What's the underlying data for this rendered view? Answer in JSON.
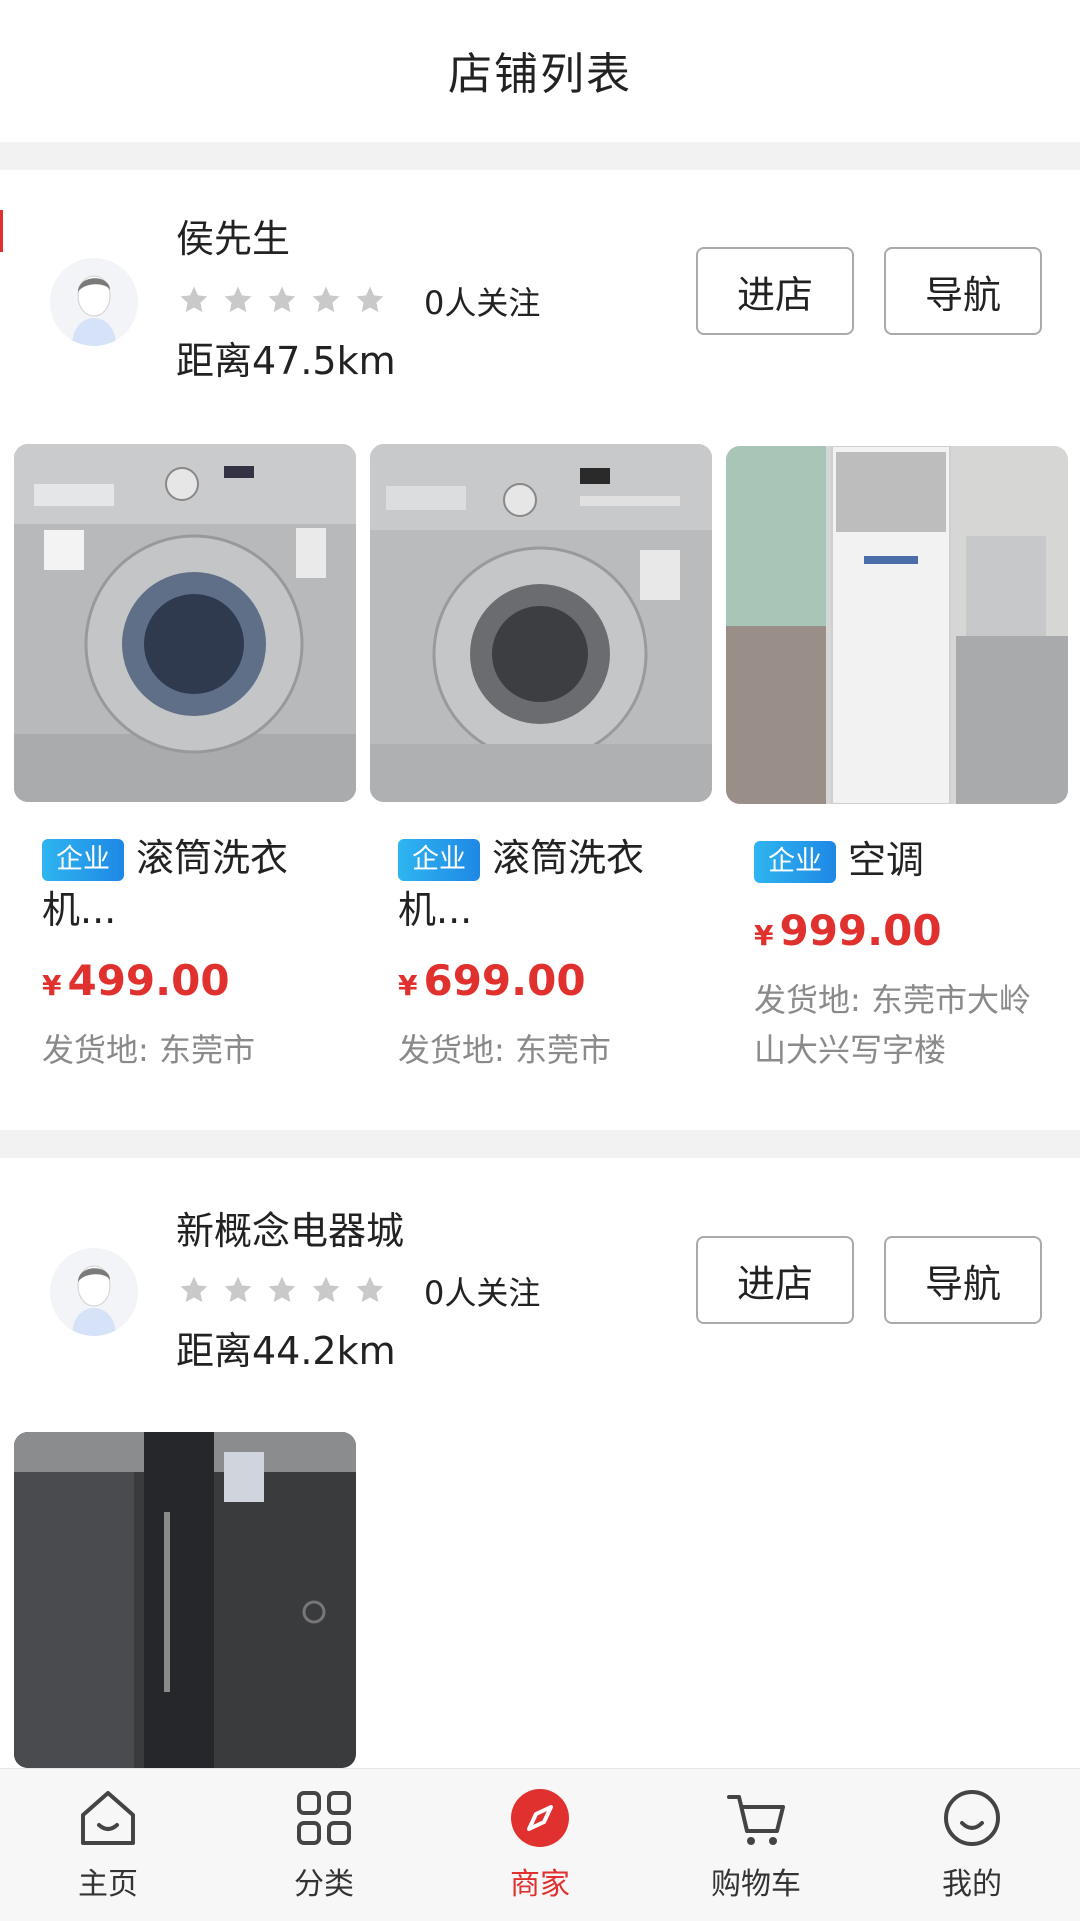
{
  "header": {
    "title": "店铺列表"
  },
  "shops": [
    {
      "name": "侯先生",
      "followers": "0人关注",
      "distance": "距离47.5km",
      "enter_label": "进店",
      "nav_label": "导航",
      "rating_stars": 0,
      "products": [
        {
          "badge": "企业",
          "title": "滚筒洗衣机...",
          "currency": "¥",
          "price": "499.00",
          "origin": "发货地: 东莞市"
        },
        {
          "badge": "企业",
          "title": "滚筒洗衣机...",
          "currency": "¥",
          "price": "699.00",
          "origin": "发货地: 东莞市"
        },
        {
          "badge": "企业",
          "title": "空调",
          "currency": "¥",
          "price": "999.00",
          "origin": "发货地: 东莞市大岭山大兴写字楼"
        }
      ]
    },
    {
      "name": "新概念电器城",
      "followers": "0人关注",
      "distance": "距离44.2km",
      "enter_label": "进店",
      "nav_label": "导航",
      "rating_stars": 0,
      "products": []
    }
  ],
  "tabbar": {
    "items": [
      {
        "label": "主页",
        "icon": "home-icon"
      },
      {
        "label": "分类",
        "icon": "grid-icon"
      },
      {
        "label": "商家",
        "icon": "compass-icon"
      },
      {
        "label": "购物车",
        "icon": "cart-icon"
      },
      {
        "label": "我的",
        "icon": "smile-icon"
      }
    ],
    "active_index": 2
  },
  "colors": {
    "accent": "#e0312f",
    "badge": "#1e9ef0",
    "star_inactive": "#c9c9c9"
  }
}
